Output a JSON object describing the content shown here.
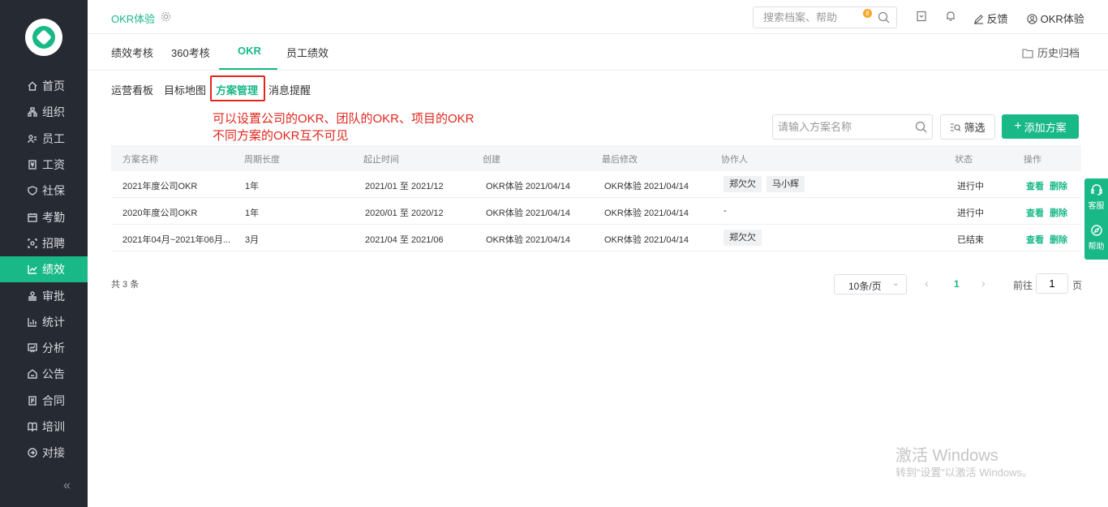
{
  "sidebar": {
    "items": [
      {
        "label": "首页",
        "icon": "home-icon"
      },
      {
        "label": "组织",
        "icon": "org-icon"
      },
      {
        "label": "员工",
        "icon": "employee-icon"
      },
      {
        "label": "工资",
        "icon": "salary-icon"
      },
      {
        "label": "社保",
        "icon": "shield-icon"
      },
      {
        "label": "考勤",
        "icon": "calendar-icon"
      },
      {
        "label": "招聘",
        "icon": "recruit-icon"
      },
      {
        "label": "绩效",
        "icon": "chart-icon",
        "active": true
      },
      {
        "label": "审批",
        "icon": "stamp-icon"
      },
      {
        "label": "统计",
        "icon": "bar-chart-icon"
      },
      {
        "label": "分析",
        "icon": "analysis-icon"
      },
      {
        "label": "公告",
        "icon": "notice-icon"
      },
      {
        "label": "合同",
        "icon": "contract-icon"
      },
      {
        "label": "培训",
        "icon": "book-icon"
      },
      {
        "label": "对接",
        "icon": "link-icon"
      }
    ],
    "collapse_label": "«"
  },
  "header": {
    "app_title": "OKR体验",
    "search_placeholder": "搜索档案、帮助",
    "notification_count": "8",
    "feedback_label": "反馈",
    "user_label": "OKR体验"
  },
  "tabs": {
    "items": [
      "绩效考核",
      "360考核",
      "OKR",
      "员工绩效"
    ],
    "active": "OKR",
    "archive_label": "历史归档"
  },
  "subtabs": {
    "items": [
      "运营看板",
      "目标地图",
      "方案管理",
      "消息提醒"
    ],
    "active": "方案管理"
  },
  "annotation": {
    "line1": "可以设置公司的OKR、团队的OKR、项目的OKR",
    "line2": "不同方案的OKR互不可见"
  },
  "toolbar": {
    "plan_search_placeholder": "请输入方案名称",
    "filter_label": "筛选",
    "add_label": "添加方案"
  },
  "table": {
    "headers": [
      "方案名称",
      "周期长度",
      "起止时间",
      "创建",
      "最后修改",
      "协作人",
      "状态",
      "操作"
    ],
    "rows": [
      {
        "name": "2021年度公司OKR",
        "cycle": "1年",
        "range": "2021/01 至 2021/12",
        "created": "OKR体验 2021/04/14",
        "modified": "OKR体验 2021/04/14",
        "collaborators": [
          "郑欠欠",
          "马小辉"
        ],
        "status": "进行中"
      },
      {
        "name": "2020年度公司OKR",
        "cycle": "1年",
        "range": "2020/01 至 2020/12",
        "created": "OKR体验 2021/04/14",
        "modified": "OKR体验 2021/04/14",
        "collaborators": [],
        "collab_empty": "-",
        "status": "进行中"
      },
      {
        "name": "2021年04月~2021年06月...",
        "cycle": "3月",
        "range": "2021/04 至 2021/06",
        "created": "OKR体验 2021/04/14",
        "modified": "OKR体验 2021/04/14",
        "collaborators": [
          "郑欠欠"
        ],
        "status": "已结束"
      }
    ],
    "action_view": "查看",
    "action_delete": "删除"
  },
  "pagination": {
    "total": "共 3 条",
    "page_size": "10条/页",
    "current_page": "1",
    "goto_label": "前往",
    "goto_value": "1",
    "page_suffix": "页"
  },
  "float_help": {
    "service_label": "客服",
    "help_label": "帮助"
  },
  "watermark": {
    "line1": "激活 Windows",
    "line2": "转到“设置”以激活 Windows。"
  },
  "colors": {
    "brand": "#19b887",
    "sidebar_bg": "#262a32",
    "annotation_red": "#e0261d"
  }
}
